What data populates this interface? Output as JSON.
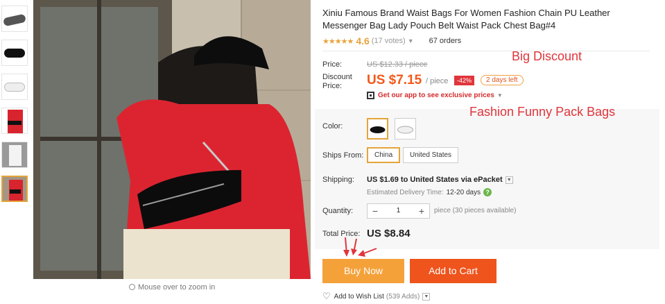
{
  "product": {
    "title": "Xiniu Famous Brand Waist Bags For Women Fashion Chain PU Leather Messenger Bag Lady Pouch Belt Waist Pack Chest Bag#4",
    "rating": "4.6",
    "rating_stars": 4.6,
    "votes": "(17 votes)",
    "orders": "67 orders"
  },
  "overlay": {
    "big_discount": "Big Discount",
    "fashion_text": "Fashion Funny Pack Bags"
  },
  "price": {
    "label": "Price:",
    "original": "US $12.33 / piece",
    "discount_label_1": "Discount",
    "discount_label_2": "Price:",
    "discounted": "US $7.15",
    "per_piece": "/ piece",
    "percent_off": "-42%",
    "days_left": "2 days left",
    "app_promo": "Get our app to see exclusive prices"
  },
  "options": {
    "color_label": "Color:",
    "colors": [
      "black",
      "white"
    ],
    "ships_from_label": "Ships From:",
    "ships_from": [
      "China",
      "United States"
    ]
  },
  "shipping": {
    "label": "Shipping:",
    "cost_text": "US $1.69 to United States via ePacket",
    "delivery_label": "Estimated Delivery Time:",
    "delivery_days": "12-20 days"
  },
  "quantity": {
    "label": "Quantity:",
    "minus": "−",
    "value": "1",
    "plus": "+",
    "available": "piece (30 pieces available)"
  },
  "total": {
    "label": "Total Price:",
    "value": "US $8.84"
  },
  "actions": {
    "buy_now": "Buy Now",
    "add_to_cart": "Add to Cart",
    "wishlist": "Add to Wish List",
    "wishlist_count": "(539 Adds)"
  },
  "gallery": {
    "zoom_hint": "Mouse over to zoom in",
    "thumbnail_count": 6,
    "active_index": 5
  },
  "colors": {
    "accent_orange": "#f5a13a",
    "cart_orange": "#ee541c",
    "price_red": "#f2581a",
    "annotation_red": "#e0353c"
  }
}
